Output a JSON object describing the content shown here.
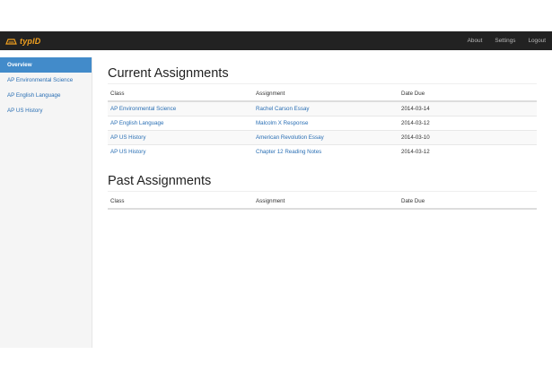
{
  "navbar": {
    "brand": "typID",
    "links": [
      "About",
      "Settings",
      "Logout"
    ]
  },
  "sidebar": {
    "items": [
      {
        "label": "Overview",
        "active": true
      },
      {
        "label": "AP Environmental Science",
        "active": false
      },
      {
        "label": "AP English Language",
        "active": false
      },
      {
        "label": "AP US History",
        "active": false
      }
    ]
  },
  "current": {
    "title": "Current Assignments",
    "headers": [
      "Class",
      "Assignment",
      "Date Due"
    ],
    "rows": [
      {
        "class": "AP Environmental Science",
        "assignment": "Rachel Carson Essay",
        "due": "2014-03-14"
      },
      {
        "class": "AP English Language",
        "assignment": "Malcolm X Response",
        "due": "2014-03-12"
      },
      {
        "class": "AP US History",
        "assignment": "American Revolution Essay",
        "due": "2014-03-10"
      },
      {
        "class": "AP US History",
        "assignment": "Chapter 12 Reading Notes",
        "due": "2014-03-12"
      }
    ]
  },
  "past": {
    "title": "Past Assignments",
    "headers": [
      "Class",
      "Assignment",
      "Date Due"
    ],
    "rows": []
  },
  "colors": {
    "navbar": "#222222",
    "brand": "#f0a020",
    "link": "#2a6fb4",
    "active": "#428bca"
  }
}
